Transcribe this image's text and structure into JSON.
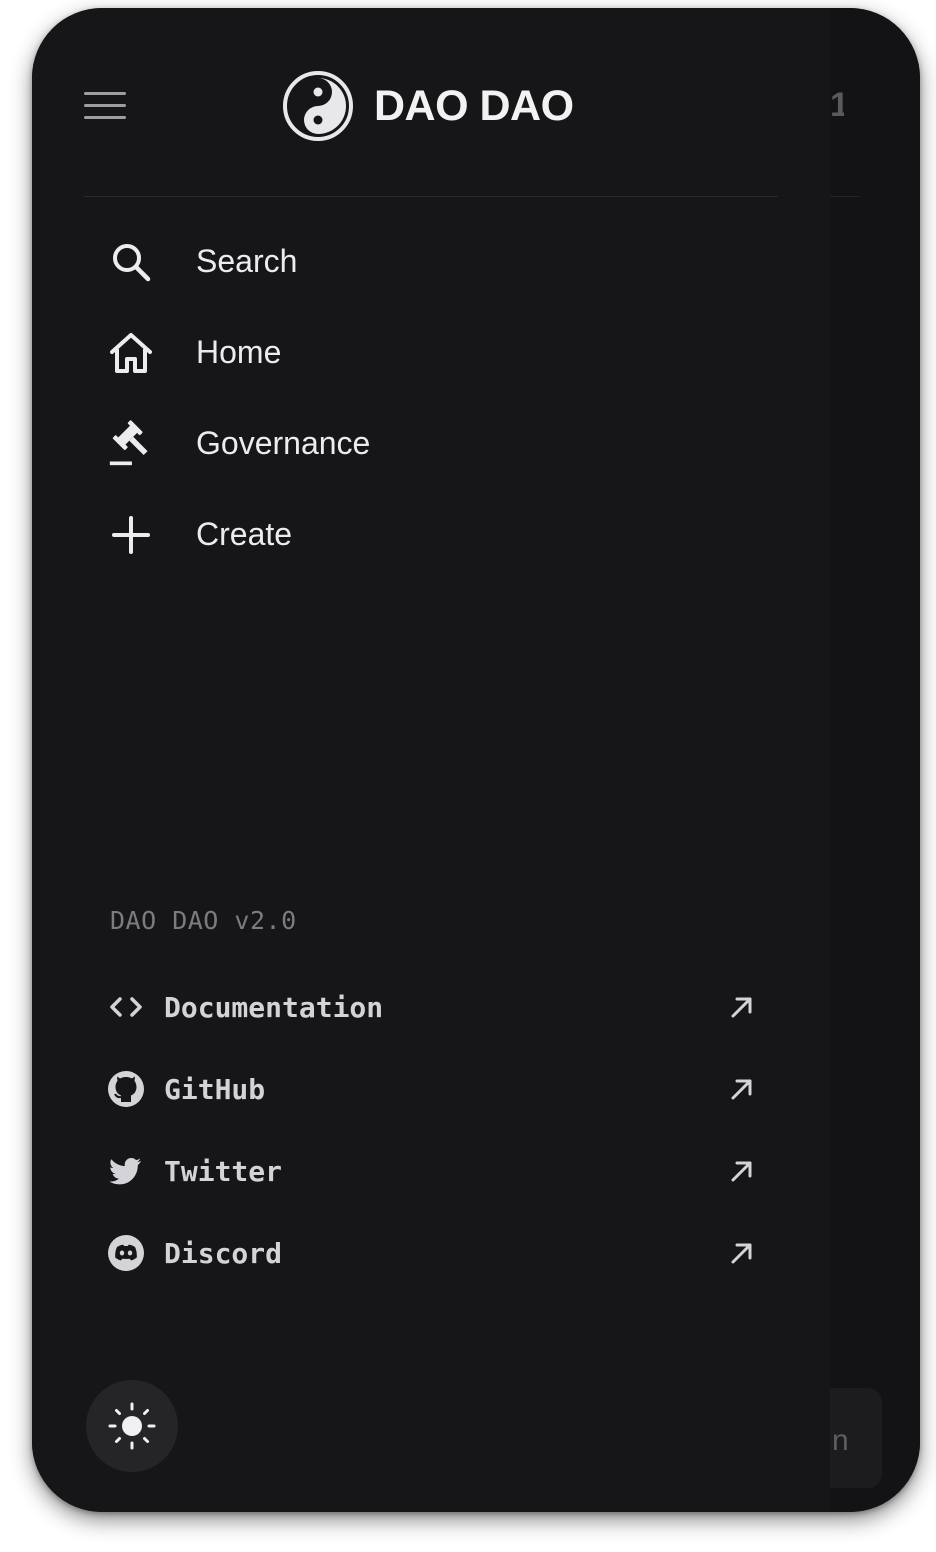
{
  "header": {
    "app_name": "DAO DAO",
    "menu_icon": "hamburger-menu-icon",
    "logo_icon": "yin-yang-logo-icon"
  },
  "nav": {
    "items": [
      {
        "label": "Search",
        "icon": "search-icon"
      },
      {
        "label": "Home",
        "icon": "home-icon"
      },
      {
        "label": "Governance",
        "icon": "gavel-icon"
      },
      {
        "label": "Create",
        "icon": "plus-icon"
      }
    ]
  },
  "footer": {
    "version": "DAO DAO v2.0",
    "links": [
      {
        "label": "Documentation",
        "icon": "code-icon",
        "external_icon": "arrow-up-right-icon"
      },
      {
        "label": "GitHub",
        "icon": "github-icon",
        "external_icon": "arrow-up-right-icon"
      },
      {
        "label": "Twitter",
        "icon": "twitter-icon",
        "external_icon": "arrow-up-right-icon"
      },
      {
        "label": "Discord",
        "icon": "discord-icon",
        "external_icon": "arrow-up-right-icon"
      }
    ],
    "theme_toggle_icon": "sun-icon"
  },
  "background_app": {
    "partial_text": "n"
  },
  "colors": {
    "drawer_bg": "#161618",
    "text_primary": "#ececee",
    "text_secondary": "#d4d4d8",
    "text_muted": "#7b7b80",
    "toggle_bg": "#252528"
  }
}
